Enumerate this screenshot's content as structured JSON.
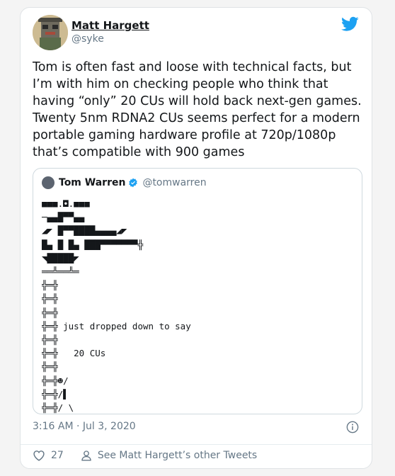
{
  "author": {
    "name": "Matt Hargett",
    "handle": "@syke"
  },
  "tweet": {
    "text": "Tom is often fast and loose with technical facts, but I’m with him on checking people who think that having “only” 20 CUs will hold back next-gen games. Twenty 5nm RDNA2 CUs seems perfect for a modern portable gaming hardware profile at 720p/1080p that’s compatible with 900 games"
  },
  "quote": {
    "name": "Tom Warren",
    "handle": "@tomwarren",
    "art_lines": [
      "■■■.◘.■■■",
      "─▄▄█▀▀▄▄",
      "◢◤ █▀▀████▄▄▄▄◢◤",
      "█▄ █ █▄ ███▀▀▀▀▀▀▀╬",
      "◥█████◤",
      "══╩══╩═",
      "╬═╬",
      "╬═╬",
      "╬═╬",
      "╬═╬ just dropped down to say",
      "╬═╬",
      "╬═╬   20 CUs",
      "╬═╬",
      "╬═╬☻/",
      "╬═╬/▌",
      "╬═╬/ \\"
    ]
  },
  "meta": {
    "timestamp": "3:16 AM · Jul 3, 2020",
    "likes": "27",
    "other_tweets": "See Matt Hargett’s other Tweets"
  },
  "colors": {
    "twitter_blue": "#1da1f2",
    "muted": "#657786",
    "text": "#14171a"
  },
  "icons": [
    "twitter-bird-icon",
    "verified-badge-icon",
    "info-icon",
    "heart-icon",
    "person-icon"
  ]
}
